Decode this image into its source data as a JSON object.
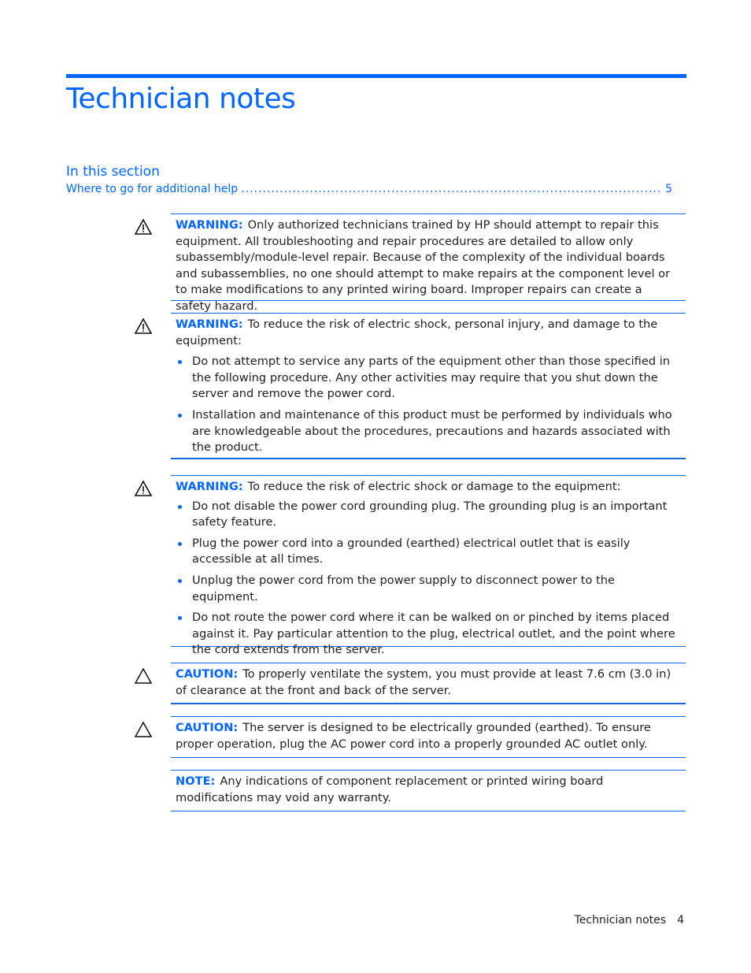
{
  "page": {
    "title": "Technician notes",
    "accent_color": "#0066ff"
  },
  "in_this_section": {
    "heading": "In this section",
    "entries": [
      {
        "label": "Where to go for additional help",
        "page": "5"
      }
    ]
  },
  "notices": [
    {
      "type": "warning",
      "icon": "warning-triangle-exclamation-icon",
      "label": "WARNING:",
      "text": "Only authorized technicians trained by HP should attempt to repair this equipment. All troubleshooting and repair procedures are detailed to allow only subassembly/module-level repair. Because of the complexity of the individual boards and subassemblies, no one should attempt to make repairs at the component level or to make modifications to any printed wiring board. Improper repairs can create a safety hazard.",
      "bullets": []
    },
    {
      "type": "warning",
      "icon": "warning-triangle-exclamation-icon",
      "label": "WARNING:",
      "text": "To reduce the risk of electric shock, personal injury, and damage to the equipment:",
      "bullets": [
        "Do not attempt to service any parts of the equipment other than those specified in the following procedure. Any other activities may require that you shut down the server and remove the power cord.",
        "Installation and maintenance of this product must be performed by individuals who are knowledgeable about the procedures, precautions and hazards associated with the product."
      ]
    },
    {
      "type": "warning",
      "icon": "warning-triangle-exclamation-icon",
      "label": "WARNING:",
      "text": "To reduce the risk of electric shock or damage to the equipment:",
      "bullets": [
        "Do not disable the power cord grounding plug. The grounding plug is an important safety feature.",
        "Plug the power cord into a grounded (earthed) electrical outlet that is easily accessible at all times.",
        "Unplug the power cord from the power supply to disconnect power to the equipment.",
        "Do not route the power cord where it can be walked on or pinched by items placed against it. Pay particular attention to the plug, electrical outlet, and the point where the cord extends from the server."
      ]
    },
    {
      "type": "caution",
      "icon": "caution-triangle-icon",
      "label": "CAUTION:",
      "text": "To properly ventilate the system, you must provide at least 7.6 cm (3.0 in) of clearance at the front and back of the server.",
      "bullets": []
    },
    {
      "type": "caution",
      "icon": "caution-triangle-icon",
      "label": "CAUTION:",
      "text": "The server is designed to be electrically grounded (earthed). To ensure proper operation, plug the AC power cord into a properly grounded AC outlet only.",
      "bullets": []
    },
    {
      "type": "note",
      "icon": "",
      "label": "NOTE:",
      "text": "Any indications of component replacement or printed wiring board modifications may void any warranty.",
      "bullets": []
    }
  ],
  "footer": {
    "section": "Technician notes",
    "page_number": "4"
  }
}
